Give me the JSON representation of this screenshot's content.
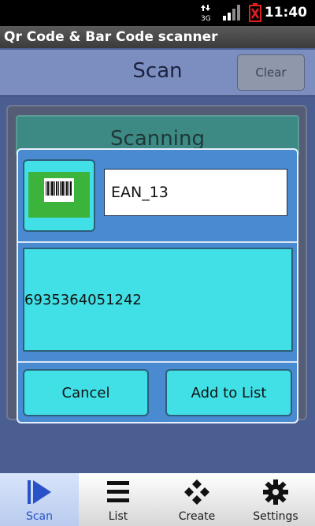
{
  "status_bar": {
    "time": "11:40",
    "network": "3G"
  },
  "app_title": "Qr Code & Bar Code scanner",
  "header": {
    "title": "Scan",
    "clear_label": "Clear"
  },
  "scanning_label": "Scanning",
  "dialog": {
    "code_type": "EAN_13",
    "code_value": "6935364051242",
    "cancel_label": "Cancel",
    "add_label": "Add to List"
  },
  "nav": {
    "items": [
      {
        "label": "Scan",
        "icon": "play-icon",
        "active": true
      },
      {
        "label": "List",
        "icon": "list-icon",
        "active": false
      },
      {
        "label": "Create",
        "icon": "diamond-pattern-icon",
        "active": false
      },
      {
        "label": "Settings",
        "icon": "gear-icon",
        "active": false
      }
    ]
  },
  "colors": {
    "accent_cyan": "#40e0e6",
    "dialog_blue": "#4a8ad0",
    "active_nav_text": "#2a52c8"
  }
}
